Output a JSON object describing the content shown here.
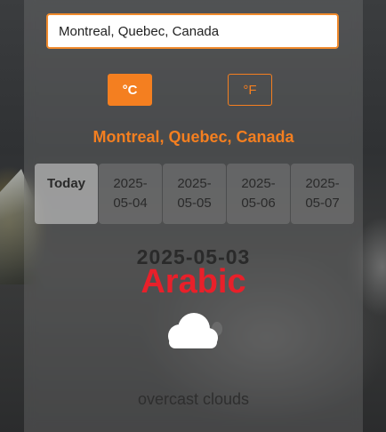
{
  "search": {
    "value": "Montreal, Quebec, Canada"
  },
  "units": {
    "celsius_label": "°C",
    "fahrenheit_label": "°F",
    "accent_color": "#f47f20"
  },
  "location": {
    "city": "Montreal, Quebec, Canada"
  },
  "days": [
    {
      "label": "Today",
      "active": true
    },
    {
      "label": "2025-05-04",
      "active": false
    },
    {
      "label": "2025-05-05",
      "active": false
    },
    {
      "label": "2025-05-06",
      "active": false
    },
    {
      "label": "2025-05-07",
      "active": false
    }
  ],
  "forecast": {
    "date": "2025-05-03",
    "language": "Arabic",
    "icon": "cloud-icon",
    "description": "overcast clouds"
  }
}
